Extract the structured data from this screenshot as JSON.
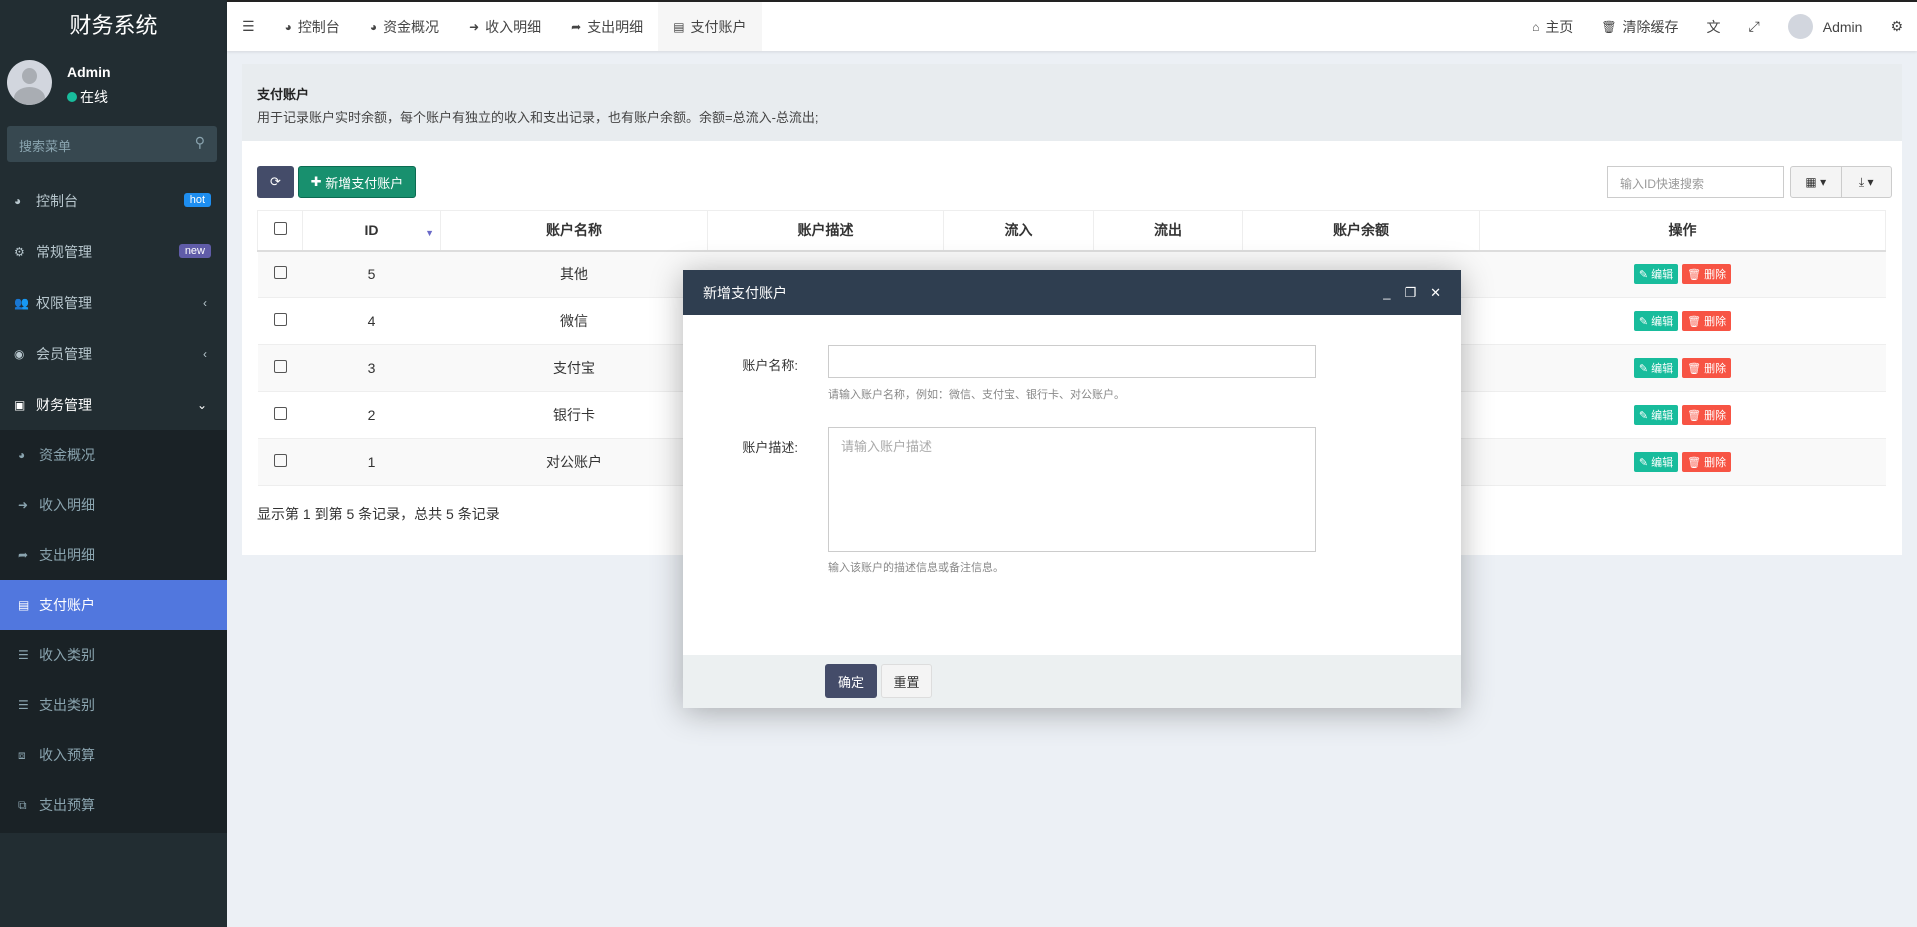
{
  "app": {
    "title": "财务系统"
  },
  "user": {
    "name": "Admin",
    "status": "在线"
  },
  "search": {
    "placeholder": "搜索菜单"
  },
  "sidebar": {
    "items": [
      {
        "label": "控制台",
        "icon": "dashboard-icon",
        "badge": "hot"
      },
      {
        "label": "常规管理",
        "icon": "cogs-icon",
        "badge": "new"
      },
      {
        "label": "权限管理",
        "icon": "group-icon"
      },
      {
        "label": "会员管理",
        "icon": "user-circle-icon"
      },
      {
        "label": "财务管理",
        "icon": "money-icon"
      }
    ],
    "sub": [
      {
        "label": "资金概况"
      },
      {
        "label": "收入明细"
      },
      {
        "label": "支出明细"
      },
      {
        "label": "支付账户"
      },
      {
        "label": "收入类别"
      },
      {
        "label": "支出类别"
      },
      {
        "label": "收入预算"
      },
      {
        "label": "支出预算"
      }
    ]
  },
  "tabs": [
    "控制台",
    "资金概况",
    "收入明细",
    "支出明细",
    "支付账户"
  ],
  "topright": {
    "home": "主页",
    "clear": "清除缓存",
    "user": "Admin"
  },
  "page": {
    "title": "支付账户",
    "desc": "用于记录账户实时余额，每个账户有独立的收入和支出记录，也有账户余额。余额=总流入-总流出;"
  },
  "toolbar": {
    "add": "新增支付账户",
    "quick_search": "输入ID快速搜索"
  },
  "table": {
    "headers": [
      "ID",
      "账户名称",
      "账户描述",
      "流入",
      "流出",
      "账户余额",
      "操作"
    ],
    "rows": [
      {
        "id": "5",
        "name": "其他"
      },
      {
        "id": "4",
        "name": "微信"
      },
      {
        "id": "3",
        "name": "支付宝"
      },
      {
        "id": "2",
        "name": "银行卡"
      },
      {
        "id": "1",
        "name": "对公账户"
      }
    ],
    "edit": "编辑",
    "delete": "删除",
    "footer": "显示第 1 到第 5 条记录，总共 5 条记录"
  },
  "colors": {
    "sidebar": "#222d32",
    "active": "#5177de",
    "success": "#18bc9c",
    "danger": "#f75444",
    "modal_header": "#2f3e50"
  },
  "modal": {
    "title": "新增支付账户",
    "name_label": "账户名称:",
    "name_hint": "请输入账户名称，例如：微信、支付宝、银行卡、对公账户。",
    "desc_label": "账户描述:",
    "desc_placeholder": "请输入账户描述",
    "desc_hint": "输入该账户的描述信息或备注信息。",
    "ok": "确定",
    "reset": "重置"
  }
}
